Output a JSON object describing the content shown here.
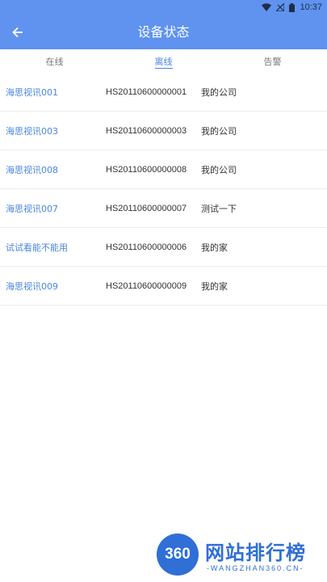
{
  "status_bar": {
    "time": "10:37"
  },
  "header": {
    "title": "设备状态",
    "back_icon": "arrow-left-icon",
    "background": "#5f93ef"
  },
  "tabs": [
    {
      "label": "在线",
      "active": false
    },
    {
      "label": "离线",
      "active": true
    },
    {
      "label": "告警",
      "active": false
    }
  ],
  "devices": [
    {
      "name": "海思视讯001",
      "serial": "HS20110600000001",
      "company": "我的公司"
    },
    {
      "name": "海思视讯003",
      "serial": "HS20110600000003",
      "company": "我的公司"
    },
    {
      "name": "海思视讯008",
      "serial": "HS20110600000008",
      "company": "我的公司"
    },
    {
      "name": "海思视讯007",
      "serial": "HS20110600000007",
      "company": "测试一下"
    },
    {
      "name": "试试看能不能用",
      "serial": "HS20110600000006",
      "company": "我的家"
    },
    {
      "name": "海思视讯009",
      "serial": "HS20110600000009",
      "company": "我的家"
    }
  ],
  "watermark": {
    "logo_text": "360",
    "title": "网站排行榜",
    "subtitle": "-WANGZHAN360.CN-"
  },
  "colors": {
    "accent": "#4a86e0",
    "header": "#5f93ef"
  }
}
